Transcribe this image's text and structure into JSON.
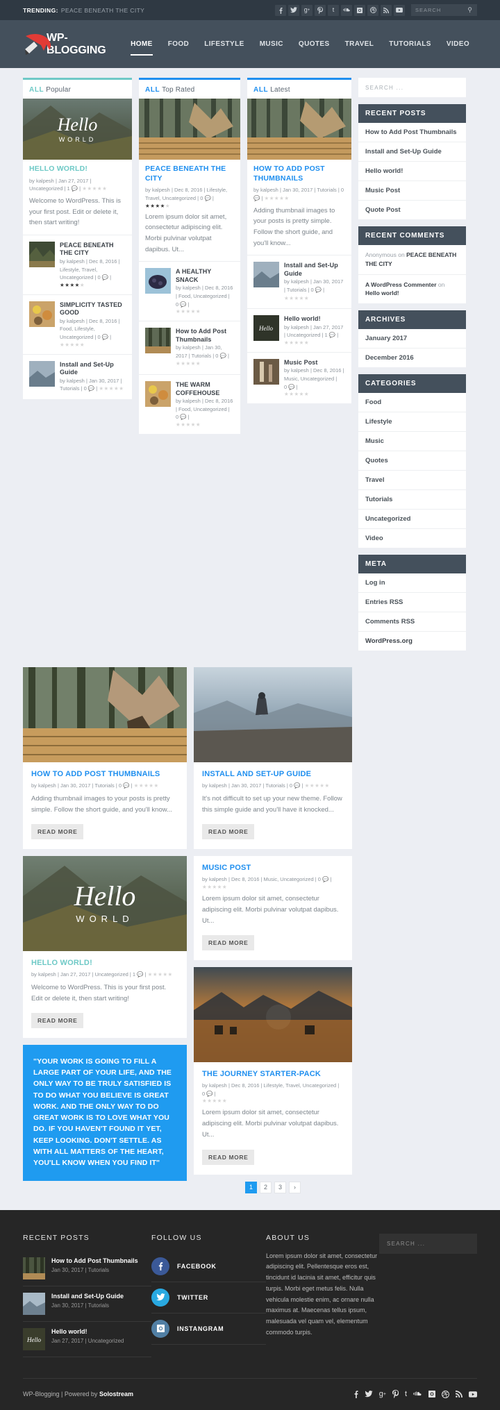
{
  "topbar": {
    "trending_label": "TRENDING:",
    "trending_text": "PEACE BENEATH THE CITY",
    "search_placeholder": "SEARCH",
    "social": [
      "facebook-icon",
      "twitter-icon",
      "google-plus-icon",
      "pinterest-icon",
      "tumblr-icon",
      "soundcloud-icon",
      "instagram-icon",
      "dribbble-icon",
      "rss-icon",
      "youtube-icon"
    ]
  },
  "header": {
    "logo_text": "WP-BLOGGING",
    "nav": [
      {
        "label": "HOME",
        "active": true
      },
      {
        "label": "FOOD",
        "active": false
      },
      {
        "label": "LIFESTYLE",
        "active": false
      },
      {
        "label": "MUSIC",
        "active": false
      },
      {
        "label": "QUOTES",
        "active": false
      },
      {
        "label": "TRAVEL",
        "active": false
      },
      {
        "label": "TUTORIALS",
        "active": false
      },
      {
        "label": "VIDEO",
        "active": false
      }
    ]
  },
  "featured": {
    "col1": {
      "all": "ALL",
      "sub": "Popular",
      "hero": {
        "image_alt": "hello-world-lake-hero",
        "overlay_top": "Hello",
        "overlay_bottom": "WORLD",
        "title": "HELLO WORLD!",
        "meta": "by kalpesh | Jan 27, 2017 | Uncategorized | 1",
        "stars": 0,
        "excerpt": "Welcome to WordPress. This is your first post. Edit or delete it, then start writing!"
      },
      "items": [
        {
          "title": "PEACE BENEATH THE CITY",
          "meta": "by kalpesh | Dec 8, 2016 | Lifestyle, Travel, Uncategorized | 0",
          "stars": 4
        },
        {
          "title": "SIMPLICITY TASTED GOOD",
          "meta": "by kalpesh | Dec 8, 2016 | Food, Lifestyle, Uncategorized | 0",
          "stars": 0
        },
        {
          "title": "Install and Set-Up Guide",
          "meta": "by kalpesh | Jan 30, 2017 | Tutorials | 0",
          "stars": 0
        }
      ]
    },
    "col2": {
      "all": "ALL",
      "sub": "Top Rated",
      "hero": {
        "image_alt": "peace-beneath-the-city-hero",
        "title": "PEACE BENEATH THE CITY",
        "meta": "by kalpesh | Dec 8, 2016 | Lifestyle, Travel, Uncategorized | 0",
        "stars": 4,
        "excerpt": "Lorem ipsum dolor sit amet, consectetur adipiscing elit. Morbi pulvinar volutpat dapibus. Ut..."
      },
      "items": [
        {
          "title": "A HEALTHY SNACK",
          "meta": "by kalpesh | Dec 8, 2016 | Food, Uncategorized | 0",
          "stars": 0
        },
        {
          "title": "How to Add Post Thumbnails",
          "meta": "by kalpesh | Jan 30, 2017 | Tutorials | 0",
          "stars": 0
        },
        {
          "title": "THE WARM COFFEHOUSE",
          "meta": "by kalpesh | Dec 8, 2016 | Food, Uncategorized | 0",
          "stars": 0
        }
      ]
    },
    "col3": {
      "all": "ALL",
      "sub": "Latest",
      "hero": {
        "image_alt": "how-to-add-post-thumbnails-hero",
        "title": "HOW TO ADD POST THUMBNAILS",
        "meta": "by kalpesh | Jan 30, 2017 | Tutorials | 0",
        "stars": 0,
        "excerpt": "Adding thumbnail images to your posts is pretty simple. Follow the short guide, and you'll know..."
      },
      "items": [
        {
          "title": "Install and Set-Up Guide",
          "meta": "by kalpesh | Jan 30, 2017 | Tutorials | 0",
          "stars": 0
        },
        {
          "title": "Hello world!",
          "meta": "by kalpesh | Jan 27, 2017 | Uncategorized | 1",
          "stars": 0
        },
        {
          "title": "Music Post",
          "meta": "by kalpesh | Dec 8, 2016 | Music, Uncategorized | 0",
          "stars": 0
        }
      ]
    }
  },
  "sidebar": {
    "search_placeholder": "SEARCH ...",
    "recent_posts": {
      "title": "RECENT POSTS",
      "items": [
        "How to Add Post Thumbnails",
        "Install and Set-Up Guide",
        "Hello world!",
        "Music Post",
        "Quote Post"
      ]
    },
    "recent_comments": {
      "title": "RECENT COMMENTS",
      "items": [
        {
          "author": "Anonymous",
          "on": "on",
          "post": "PEACE BENEATH THE CITY"
        },
        {
          "author": "A WordPress Commenter",
          "on": "on",
          "post": "Hello world!"
        }
      ]
    },
    "archives": {
      "title": "ARCHIVES",
      "items": [
        "January 2017",
        "December 2016"
      ]
    },
    "categories": {
      "title": "CATEGORIES",
      "items": [
        "Food",
        "Lifestyle",
        "Music",
        "Quotes",
        "Travel",
        "Tutorials",
        "Uncategorized",
        "Video"
      ]
    },
    "meta": {
      "title": "META",
      "items": [
        "Log in",
        "Entries RSS",
        "Comments RSS",
        "WordPress.org"
      ]
    }
  },
  "posts": {
    "left": [
      {
        "image_alt": "forest-boardwalk-photo",
        "title": "HOW TO ADD POST THUMBNAILS",
        "meta": "by kalpesh | Jan 30, 2017 | Tutorials | 0",
        "stars": 0,
        "excerpt": "Adding thumbnail images to your posts is pretty simple. Follow the short guide, and you'll know...",
        "button": "READ MORE",
        "accent": "blue"
      },
      {
        "image_alt": "hello-world-lake-photo",
        "overlay_top": "Hello",
        "overlay_bottom": "WORLD",
        "title": "HELLO WORLD!",
        "meta": "by kalpesh | Jan 27, 2017 | Uncategorized | 1",
        "stars": 0,
        "excerpt": "Welcome to WordPress. This is your first post. Edit or delete it, then start writing!",
        "button": "READ MORE",
        "accent": "teal"
      }
    ],
    "quote": "\"YOUR WORK IS GOING TO FILL A LARGE PART OF YOUR LIFE, AND THE ONLY WAY TO BE TRULY SATISFIED IS TO DO WHAT YOU BELIEVE IS GREAT WORK. AND THE ONLY WAY TO DO GREAT WORK IS TO LOVE WHAT YOU DO. IF YOU HAVEN'T FOUND IT YET, KEEP LOOKING. DON'T SETTLE. AS WITH ALL MATTERS OF THE HEART, YOU'LL KNOW WHEN YOU FIND IT\"",
    "right": [
      {
        "image_alt": "man-on-cliff-photo",
        "title": "INSTALL AND SET-UP GUIDE",
        "meta": "by kalpesh | Jan 30, 2017 | Tutorials | 0",
        "stars": 0,
        "excerpt": "It's not difficult to set up your new theme. Follow this simple guide and you'll have it knocked...",
        "button": "READ MORE",
        "accent": "blue"
      },
      {
        "image_alt": "",
        "title": "MUSIC POST",
        "meta": "by kalpesh | Dec 8, 2016 | Music, Uncategorized | 0",
        "stars": 0,
        "excerpt": "Lorem ipsum dolor sit amet, consectetur adipiscing elit. Morbi pulvinar volutpat dapibus. Ut...",
        "button": "READ MORE",
        "accent": "blue"
      },
      {
        "image_alt": "sunset-lake-horses-photo",
        "title": "THE JOURNEY STARTER-PACK",
        "meta": "by kalpesh | Dec 8, 2016 | Lifestyle, Travel, Uncategorized | 0",
        "stars": 0,
        "excerpt": "Lorem ipsum dolor sit amet, consectetur adipiscing elit. Morbi pulvinar volutpat dapibus. Ut...",
        "button": "READ MORE",
        "accent": "blue"
      }
    ]
  },
  "pagination": {
    "pages": [
      "1",
      "2",
      "3"
    ],
    "current": "1",
    "next_icon": "chevron-right-icon"
  },
  "footer": {
    "recent_posts": {
      "title": "RECENT POSTS",
      "items": [
        {
          "title": "How to Add Post Thumbnails",
          "meta_date": "Jan 30, 2017",
          "meta_cat": "Tutorials"
        },
        {
          "title": "Install and Set-Up Guide",
          "meta_date": "Jan 30, 2017",
          "meta_cat": "Tutorials"
        },
        {
          "title": "Hello world!",
          "meta_date": "Jan 27, 2017",
          "meta_cat": "Uncategorized"
        }
      ]
    },
    "follow_us": {
      "title": "FOLLOW US",
      "items": [
        {
          "label": "FACEBOOK",
          "icon": "facebook-icon",
          "color": "#3b5998"
        },
        {
          "label": "TWITTER",
          "icon": "twitter-icon",
          "color": "#29a9e1"
        },
        {
          "label": "INSTANGRAM",
          "icon": "instagram-icon",
          "color": "#517fa4"
        }
      ]
    },
    "about_us": {
      "title": "ABOUT US",
      "text": "Lorem ipsum dolor sit amet, consectetur adipiscing elit. Pellentesque eros est, tincidunt id lacinia sit amet, efficitur quis turpis. Morbi eget metus felis. Nulla vehicula molestie enim, ac ornare nulla maximus at. Maecenas tellus ipsum, malesuada vel quam vel, elementum commodo turpis."
    },
    "search_placeholder": "SEARCH ...",
    "copyright_left": "WP-Blogging",
    "copyright_sep": "|",
    "copyright_mid": "Powered by",
    "copyright_brand": "Solostream",
    "social": [
      "facebook-icon",
      "twitter-icon",
      "google-plus-icon",
      "pinterest-icon",
      "tumblr-icon",
      "soundcloud-icon",
      "instagram-icon",
      "dribbble-icon",
      "rss-icon",
      "youtube-icon"
    ]
  },
  "colors": {
    "accent_blue": "#1f8fef",
    "accent_teal": "#6ec9c6",
    "header_bg": "#44505c",
    "topbar_bg": "#2f3943",
    "footer_bg": "#262626",
    "page_bg": "#eceef3"
  }
}
